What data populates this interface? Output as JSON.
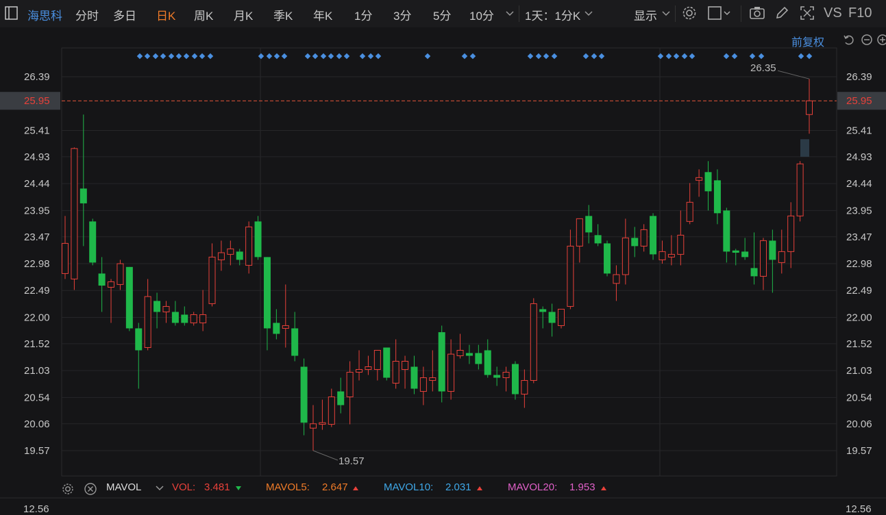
{
  "toolbar": {
    "stock_name": "海思科",
    "tabs": [
      "分时",
      "多日",
      "日K",
      "周K",
      "月K",
      "季K",
      "年K",
      "1分",
      "3分",
      "5分",
      "10分"
    ],
    "active_tab": "日K",
    "period_select": "1天：1分K",
    "display_label": "显示",
    "right_labels": [
      "VS",
      "F10"
    ]
  },
  "adjust_label": "前复权",
  "indicator": {
    "name": "MAVOL",
    "vol_label": "VOL:",
    "vol_value": "3.481",
    "ma5_label": "MAVOL5:",
    "ma5_value": "2.647",
    "ma10_label": "MAVOL10:",
    "ma10_value": "2.031",
    "ma20_label": "MAVOL20:",
    "ma20_value": "1.953",
    "bottom_tick": "12.56"
  },
  "colors": {
    "up": "#e8413a",
    "down": "#1fb84a",
    "accent": "#f07b28",
    "current_line": "#e8563a",
    "marker": "#4a8fe0",
    "preview": "#2b3a46",
    "ma5": "#f07b28",
    "ma10": "#3fa8e8",
    "ma20": "#e060c8"
  },
  "chart_data": {
    "type": "candlestick",
    "y_ticks": [
      26.39,
      25.95,
      25.41,
      24.93,
      24.44,
      23.95,
      23.47,
      22.98,
      22.49,
      22.0,
      21.52,
      21.03,
      20.54,
      20.06,
      19.57
    ],
    "y_tick_labels": [
      "26.39",
      "25.95",
      "25.41",
      "24.93",
      "24.44",
      "23.95",
      "23.47",
      "22.98",
      "22.49",
      "22.00",
      "21.52",
      "21.03",
      "20.54",
      "20.06",
      "19.57"
    ],
    "ylim": [
      19.19,
      26.85
    ],
    "current_price": 25.95,
    "current_price_label": "25.95",
    "max_label": "26.35",
    "min_label": "19.57",
    "grid": true,
    "candles": [
      {
        "o": 22.8,
        "h": 23.85,
        "l": 22.7,
        "c": 23.35
      },
      {
        "o": 22.7,
        "h": 25.1,
        "l": 22.5,
        "c": 25.08
      },
      {
        "o": 24.35,
        "h": 25.7,
        "l": 23.3,
        "c": 24.08
      },
      {
        "o": 23.75,
        "h": 23.8,
        "l": 22.95,
        "c": 23.0
      },
      {
        "o": 22.8,
        "h": 23.1,
        "l": 22.1,
        "c": 22.58
      },
      {
        "o": 22.55,
        "h": 22.7,
        "l": 21.9,
        "c": 22.65
      },
      {
        "o": 22.6,
        "h": 23.05,
        "l": 22.5,
        "c": 22.98
      },
      {
        "o": 22.92,
        "h": 22.92,
        "l": 21.75,
        "c": 21.8
      },
      {
        "o": 21.8,
        "h": 21.9,
        "l": 20.7,
        "c": 21.4
      },
      {
        "o": 21.45,
        "h": 22.7,
        "l": 21.4,
        "c": 22.38
      },
      {
        "o": 22.3,
        "h": 22.45,
        "l": 21.8,
        "c": 22.1
      },
      {
        "o": 22.1,
        "h": 22.3,
        "l": 21.9,
        "c": 22.2
      },
      {
        "o": 22.1,
        "h": 22.3,
        "l": 21.85,
        "c": 21.9
      },
      {
        "o": 22.05,
        "h": 22.2,
        "l": 21.85,
        "c": 21.9
      },
      {
        "o": 21.9,
        "h": 22.1,
        "l": 21.85,
        "c": 22.05
      },
      {
        "o": 21.9,
        "h": 22.5,
        "l": 21.75,
        "c": 22.05
      },
      {
        "o": 22.25,
        "h": 23.35,
        "l": 22.2,
        "c": 23.1
      },
      {
        "o": 23.05,
        "h": 23.4,
        "l": 22.85,
        "c": 23.18
      },
      {
        "o": 23.15,
        "h": 23.4,
        "l": 22.95,
        "c": 23.25
      },
      {
        "o": 23.2,
        "h": 23.25,
        "l": 22.95,
        "c": 23.05
      },
      {
        "o": 22.95,
        "h": 23.75,
        "l": 22.8,
        "c": 23.65
      },
      {
        "o": 23.75,
        "h": 23.85,
        "l": 23.05,
        "c": 23.1
      },
      {
        "o": 23.1,
        "h": 23.1,
        "l": 21.4,
        "c": 21.8
      },
      {
        "o": 21.9,
        "h": 22.15,
        "l": 21.6,
        "c": 21.7
      },
      {
        "o": 21.8,
        "h": 22.6,
        "l": 21.45,
        "c": 21.85
      },
      {
        "o": 21.8,
        "h": 22.1,
        "l": 21.2,
        "c": 21.3
      },
      {
        "o": 21.1,
        "h": 21.25,
        "l": 19.85,
        "c": 20.08
      },
      {
        "o": 19.98,
        "h": 20.4,
        "l": 19.57,
        "c": 20.06
      },
      {
        "o": 20.05,
        "h": 20.5,
        "l": 19.95,
        "c": 20.08
      },
      {
        "o": 20.05,
        "h": 20.7,
        "l": 20.0,
        "c": 20.55
      },
      {
        "o": 20.65,
        "h": 20.9,
        "l": 20.25,
        "c": 20.4
      },
      {
        "o": 20.55,
        "h": 21.2,
        "l": 20.05,
        "c": 21.0
      },
      {
        "o": 21.0,
        "h": 21.4,
        "l": 20.85,
        "c": 21.05
      },
      {
        "o": 21.05,
        "h": 21.3,
        "l": 20.95,
        "c": 21.1
      },
      {
        "o": 21.05,
        "h": 21.4,
        "l": 20.85,
        "c": 21.4
      },
      {
        "o": 21.45,
        "h": 21.45,
        "l": 20.85,
        "c": 20.9
      },
      {
        "o": 20.8,
        "h": 21.6,
        "l": 20.7,
        "c": 21.2
      },
      {
        "o": 21.05,
        "h": 21.3,
        "l": 20.7,
        "c": 21.2
      },
      {
        "o": 21.1,
        "h": 21.3,
        "l": 20.6,
        "c": 20.7
      },
      {
        "o": 20.65,
        "h": 21.1,
        "l": 20.4,
        "c": 20.9
      },
      {
        "o": 20.85,
        "h": 21.4,
        "l": 20.65,
        "c": 20.9
      },
      {
        "o": 21.73,
        "h": 21.85,
        "l": 20.45,
        "c": 20.65
      },
      {
        "o": 20.65,
        "h": 21.6,
        "l": 20.5,
        "c": 21.33
      },
      {
        "o": 21.3,
        "h": 21.7,
        "l": 21.25,
        "c": 21.4
      },
      {
        "o": 21.35,
        "h": 21.5,
        "l": 21.15,
        "c": 21.3
      },
      {
        "o": 21.35,
        "h": 21.5,
        "l": 21.05,
        "c": 21.15
      },
      {
        "o": 21.4,
        "h": 21.6,
        "l": 20.9,
        "c": 20.95
      },
      {
        "o": 20.95,
        "h": 21.1,
        "l": 20.75,
        "c": 20.9
      },
      {
        "o": 20.9,
        "h": 21.1,
        "l": 20.65,
        "c": 21.0
      },
      {
        "o": 21.15,
        "h": 21.2,
        "l": 20.5,
        "c": 20.6
      },
      {
        "o": 20.6,
        "h": 21.05,
        "l": 20.35,
        "c": 20.85
      },
      {
        "o": 20.85,
        "h": 22.35,
        "l": 20.8,
        "c": 22.25
      },
      {
        "o": 22.15,
        "h": 22.2,
        "l": 21.8,
        "c": 22.1
      },
      {
        "o": 22.1,
        "h": 22.25,
        "l": 21.65,
        "c": 21.9
      },
      {
        "o": 21.85,
        "h": 22.15,
        "l": 21.8,
        "c": 22.15
      },
      {
        "o": 22.2,
        "h": 23.6,
        "l": 22.15,
        "c": 23.3
      },
      {
        "o": 23.3,
        "h": 23.8,
        "l": 23.0,
        "c": 23.8
      },
      {
        "o": 23.85,
        "h": 24.05,
        "l": 23.35,
        "c": 23.55
      },
      {
        "o": 23.5,
        "h": 23.7,
        "l": 23.3,
        "c": 23.35
      },
      {
        "o": 23.35,
        "h": 23.4,
        "l": 22.75,
        "c": 22.8
      },
      {
        "o": 22.62,
        "h": 22.95,
        "l": 22.3,
        "c": 22.78
      },
      {
        "o": 22.78,
        "h": 23.8,
        "l": 22.6,
        "c": 23.45
      },
      {
        "o": 23.45,
        "h": 23.65,
        "l": 23.1,
        "c": 23.3
      },
      {
        "o": 23.3,
        "h": 23.7,
        "l": 23.2,
        "c": 23.6
      },
      {
        "o": 23.85,
        "h": 23.9,
        "l": 23.05,
        "c": 23.15
      },
      {
        "o": 23.05,
        "h": 23.4,
        "l": 22.98,
        "c": 23.2
      },
      {
        "o": 23.1,
        "h": 23.5,
        "l": 22.95,
        "c": 23.15
      },
      {
        "o": 23.15,
        "h": 23.95,
        "l": 22.95,
        "c": 23.5
      },
      {
        "o": 23.75,
        "h": 24.45,
        "l": 23.7,
        "c": 24.1
      },
      {
        "o": 24.5,
        "h": 24.7,
        "l": 24.2,
        "c": 24.55
      },
      {
        "o": 24.65,
        "h": 24.85,
        "l": 23.95,
        "c": 24.3
      },
      {
        "o": 24.5,
        "h": 24.7,
        "l": 23.7,
        "c": 23.9
      },
      {
        "o": 23.95,
        "h": 24.0,
        "l": 23.0,
        "c": 23.2
      },
      {
        "o": 23.22,
        "h": 23.25,
        "l": 22.95,
        "c": 23.18
      },
      {
        "o": 23.2,
        "h": 23.45,
        "l": 23.05,
        "c": 23.1
      },
      {
        "o": 22.9,
        "h": 23.55,
        "l": 22.6,
        "c": 22.75
      },
      {
        "o": 22.75,
        "h": 23.45,
        "l": 22.5,
        "c": 23.4
      },
      {
        "o": 23.4,
        "h": 23.6,
        "l": 22.45,
        "c": 23.05
      },
      {
        "o": 23.0,
        "h": 23.6,
        "l": 22.8,
        "c": 23.2
      },
      {
        "o": 23.2,
        "h": 24.1,
        "l": 22.9,
        "c": 23.85
      },
      {
        "o": 23.85,
        "h": 24.85,
        "l": 23.75,
        "c": 24.8
      },
      {
        "o": 25.7,
        "h": 26.35,
        "l": 25.35,
        "c": 25.95
      }
    ],
    "preview_candle": {
      "o": 25.25,
      "h": 25.25,
      "l": 24.93,
      "c": 24.93
    }
  }
}
